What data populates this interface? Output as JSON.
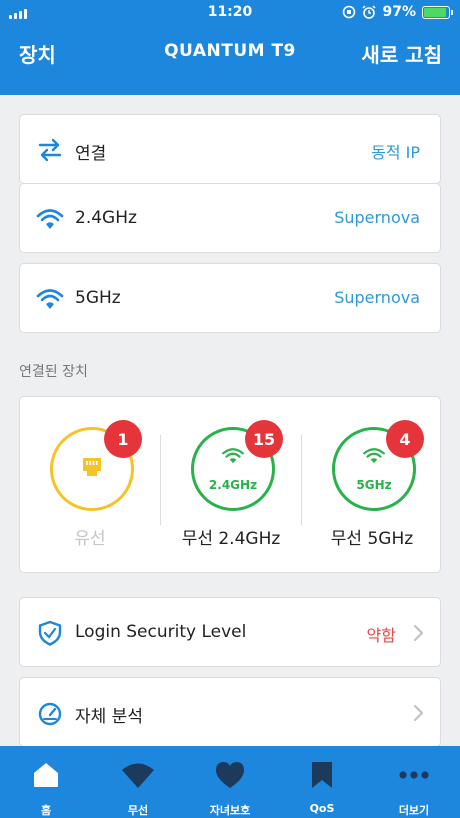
{
  "status_bar": {
    "time": "11:20",
    "battery": "97%"
  },
  "navbar": {
    "left": "장치",
    "title": "QUANTUM T9",
    "right": "새로 고침"
  },
  "rows": [
    {
      "label": "연결",
      "value": "동적 IP",
      "icon": "swap-arrows-icon"
    },
    {
      "label": "2.4GHz",
      "value": "Supernova",
      "icon": "wifi-icon"
    },
    {
      "label": "5GHz",
      "value": "Supernova",
      "icon": "wifi-icon"
    }
  ],
  "section_label": "연결된 장치",
  "devices": [
    {
      "label": "유선",
      "count": "1",
      "band": "",
      "color": "#f6c327"
    },
    {
      "label": "무선 2.4GHz",
      "count": "15",
      "band": "2.4GHz",
      "color": "#27b24a"
    },
    {
      "label": "무선 5GHz",
      "count": "4",
      "band": "5GHz",
      "color": "#27b24a"
    }
  ],
  "security": {
    "label": "Login Security Level",
    "value": "약함"
  },
  "diagnosis": {
    "label": "자체 분석"
  },
  "tabs": [
    {
      "label": "홈",
      "icon": "home-icon"
    },
    {
      "label": "무선",
      "icon": "wifi-icon"
    },
    {
      "label": "자녀보호",
      "icon": "heart-icon"
    },
    {
      "label": "QoS",
      "icon": "bookmark-icon"
    },
    {
      "label": "더보기",
      "icon": "more-icon"
    }
  ],
  "colors": {
    "primary": "#1d86dd",
    "accent_text": "#2b9bd8",
    "warning": "#e24a4a",
    "badge": "#e5353b",
    "wired": "#f6c327",
    "wireless": "#27b24a"
  }
}
